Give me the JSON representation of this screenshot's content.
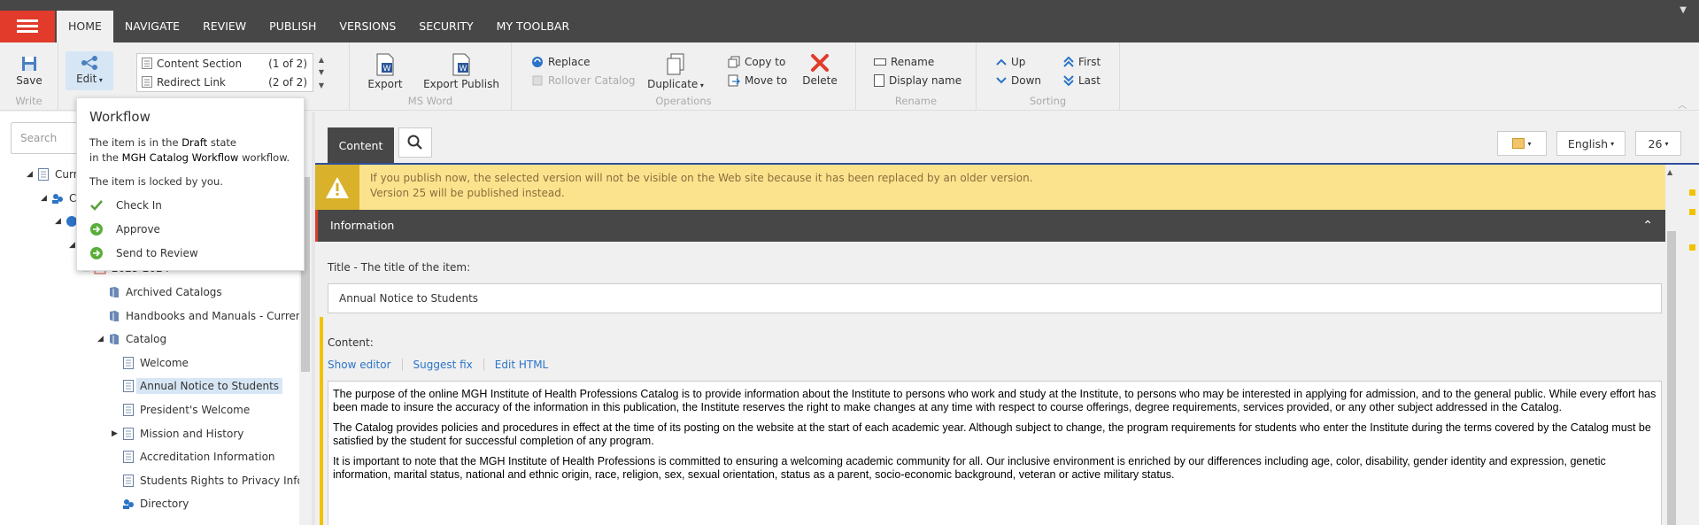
{
  "topbar": {
    "tabs": [
      "HOME",
      "NAVIGATE",
      "REVIEW",
      "PUBLISH",
      "VERSIONS",
      "SECURITY",
      "MY TOOLBAR"
    ],
    "active_tab": "HOME"
  },
  "ribbon": {
    "write": {
      "save": "Save",
      "label": "Write"
    },
    "edit": {
      "edit": "Edit"
    },
    "gallery": [
      {
        "label": "Content Section",
        "count": "(1 of 2)"
      },
      {
        "label": "Redirect Link",
        "count": "(2 of 2)"
      }
    ],
    "msword": {
      "export": "Export",
      "export_publish": "Export Publish",
      "label": "MS Word"
    },
    "operations": {
      "replace": "Replace",
      "rollover": "Rollover Catalog",
      "duplicate": "Duplicate",
      "copy_to": "Copy to",
      "move_to": "Move to",
      "delete": "Delete",
      "label": "Operations"
    },
    "rename": {
      "rename": "Rename",
      "display_name": "Display name",
      "label": "Rename"
    },
    "sorting": {
      "up": "Up",
      "down": "Down",
      "first": "First",
      "last": "Last",
      "label": "Sorting"
    }
  },
  "left": {
    "search_placeholder": "Search",
    "tree": [
      {
        "label": "Curr",
        "level": 0,
        "tri": "open",
        "icon": "page"
      },
      {
        "label": "C",
        "level": 1,
        "tri": "open",
        "icon": "people"
      },
      {
        "label": "",
        "level": 2,
        "tri": "open",
        "icon": "globe"
      },
      {
        "label": "",
        "level": 3,
        "tri": "open",
        "icon": "folder"
      },
      {
        "label": "2023-2024",
        "level": 4,
        "tri": "open",
        "icon": "calendar"
      },
      {
        "label": "Archived Catalogs",
        "level": 5,
        "tri": "none",
        "icon": "book"
      },
      {
        "label": "Handbooks and Manuals - Curren",
        "level": 5,
        "tri": "none",
        "icon": "book"
      },
      {
        "label": "Catalog",
        "level": 5,
        "tri": "open",
        "icon": "book"
      },
      {
        "label": "Welcome",
        "level": 6,
        "tri": "none",
        "icon": "page"
      },
      {
        "label": "Annual Notice to Students",
        "level": 6,
        "tri": "none",
        "icon": "page",
        "selected": true
      },
      {
        "label": "President's Welcome",
        "level": 6,
        "tri": "none",
        "icon": "page"
      },
      {
        "label": "Mission and History",
        "level": 6,
        "tri": "closed",
        "icon": "page"
      },
      {
        "label": "Accreditation Information",
        "level": 6,
        "tri": "none",
        "icon": "page"
      },
      {
        "label": "Students Rights to Privacy Infor",
        "level": 6,
        "tri": "none",
        "icon": "page"
      },
      {
        "label": "Directory",
        "level": 6,
        "tri": "none",
        "icon": "people"
      }
    ]
  },
  "workflow": {
    "title": "Workflow",
    "state_line1_pre": "The item is in the ",
    "state_name": "Draft",
    "state_line1_post": " state",
    "state_line2_pre": "in the ",
    "workflow_name": "MGH Catalog Workflow",
    "state_line2_post": " workflow.",
    "locked_pre": "The item is locked by ",
    "locked_by": "you",
    "locked_post": ".",
    "actions": [
      "Check In",
      "Approve",
      "Send to Review"
    ]
  },
  "content": {
    "tab_label": "Content",
    "language": "English",
    "version": "26",
    "warning_line1": "If you publish now, the selected version will not be visible on the Web site because it has been replaced by an older version.",
    "warning_line2": "Version 25 will be published instead.",
    "section_title": "Information",
    "title_label": "Title - The title of the item:",
    "title_value": "Annual Notice to Students",
    "content_label": "Content:",
    "editor_links": [
      "Show editor",
      "Suggest fix",
      "Edit HTML"
    ],
    "paragraphs": [
      "The purpose of the online MGH Institute of Health Professions Catalog is to provide information about the Institute to persons who work and study at the Institute, to persons who may be interested in applying for admission, and to the general public. While every effort has been made to insure the accuracy of the information in this publication, the Institute reserves the right to make changes at any time with respect to course offerings, degree requirements, services provided, or any other subject addressed in the Catalog.",
      "The Catalog provides policies and procedures in effect at the time of its posting on the website at the start of each academic year.  Although subject to change, the program requirements for students who enter the Institute during the terms covered by the Catalog must be satisfied by the student for successful completion of any program.",
      "It is important to note that the MGH Institute of Health Professions is committed to ensuring a welcoming academic community for all. Our inclusive environment is enriched by our differences including age, color, disability, gender identity and expression, genetic information, marital status, national and ethnic origin, race, religion, sex, sexual orientation, status as a parent, socio-economic background, veteran or active military status."
    ]
  },
  "colors": {
    "accent_red": "#e23b2b",
    "dark_bar": "#474747",
    "warning_bg": "#fbe38e",
    "link_blue": "#2b74c7",
    "marker_yellow": "#f2c200"
  }
}
